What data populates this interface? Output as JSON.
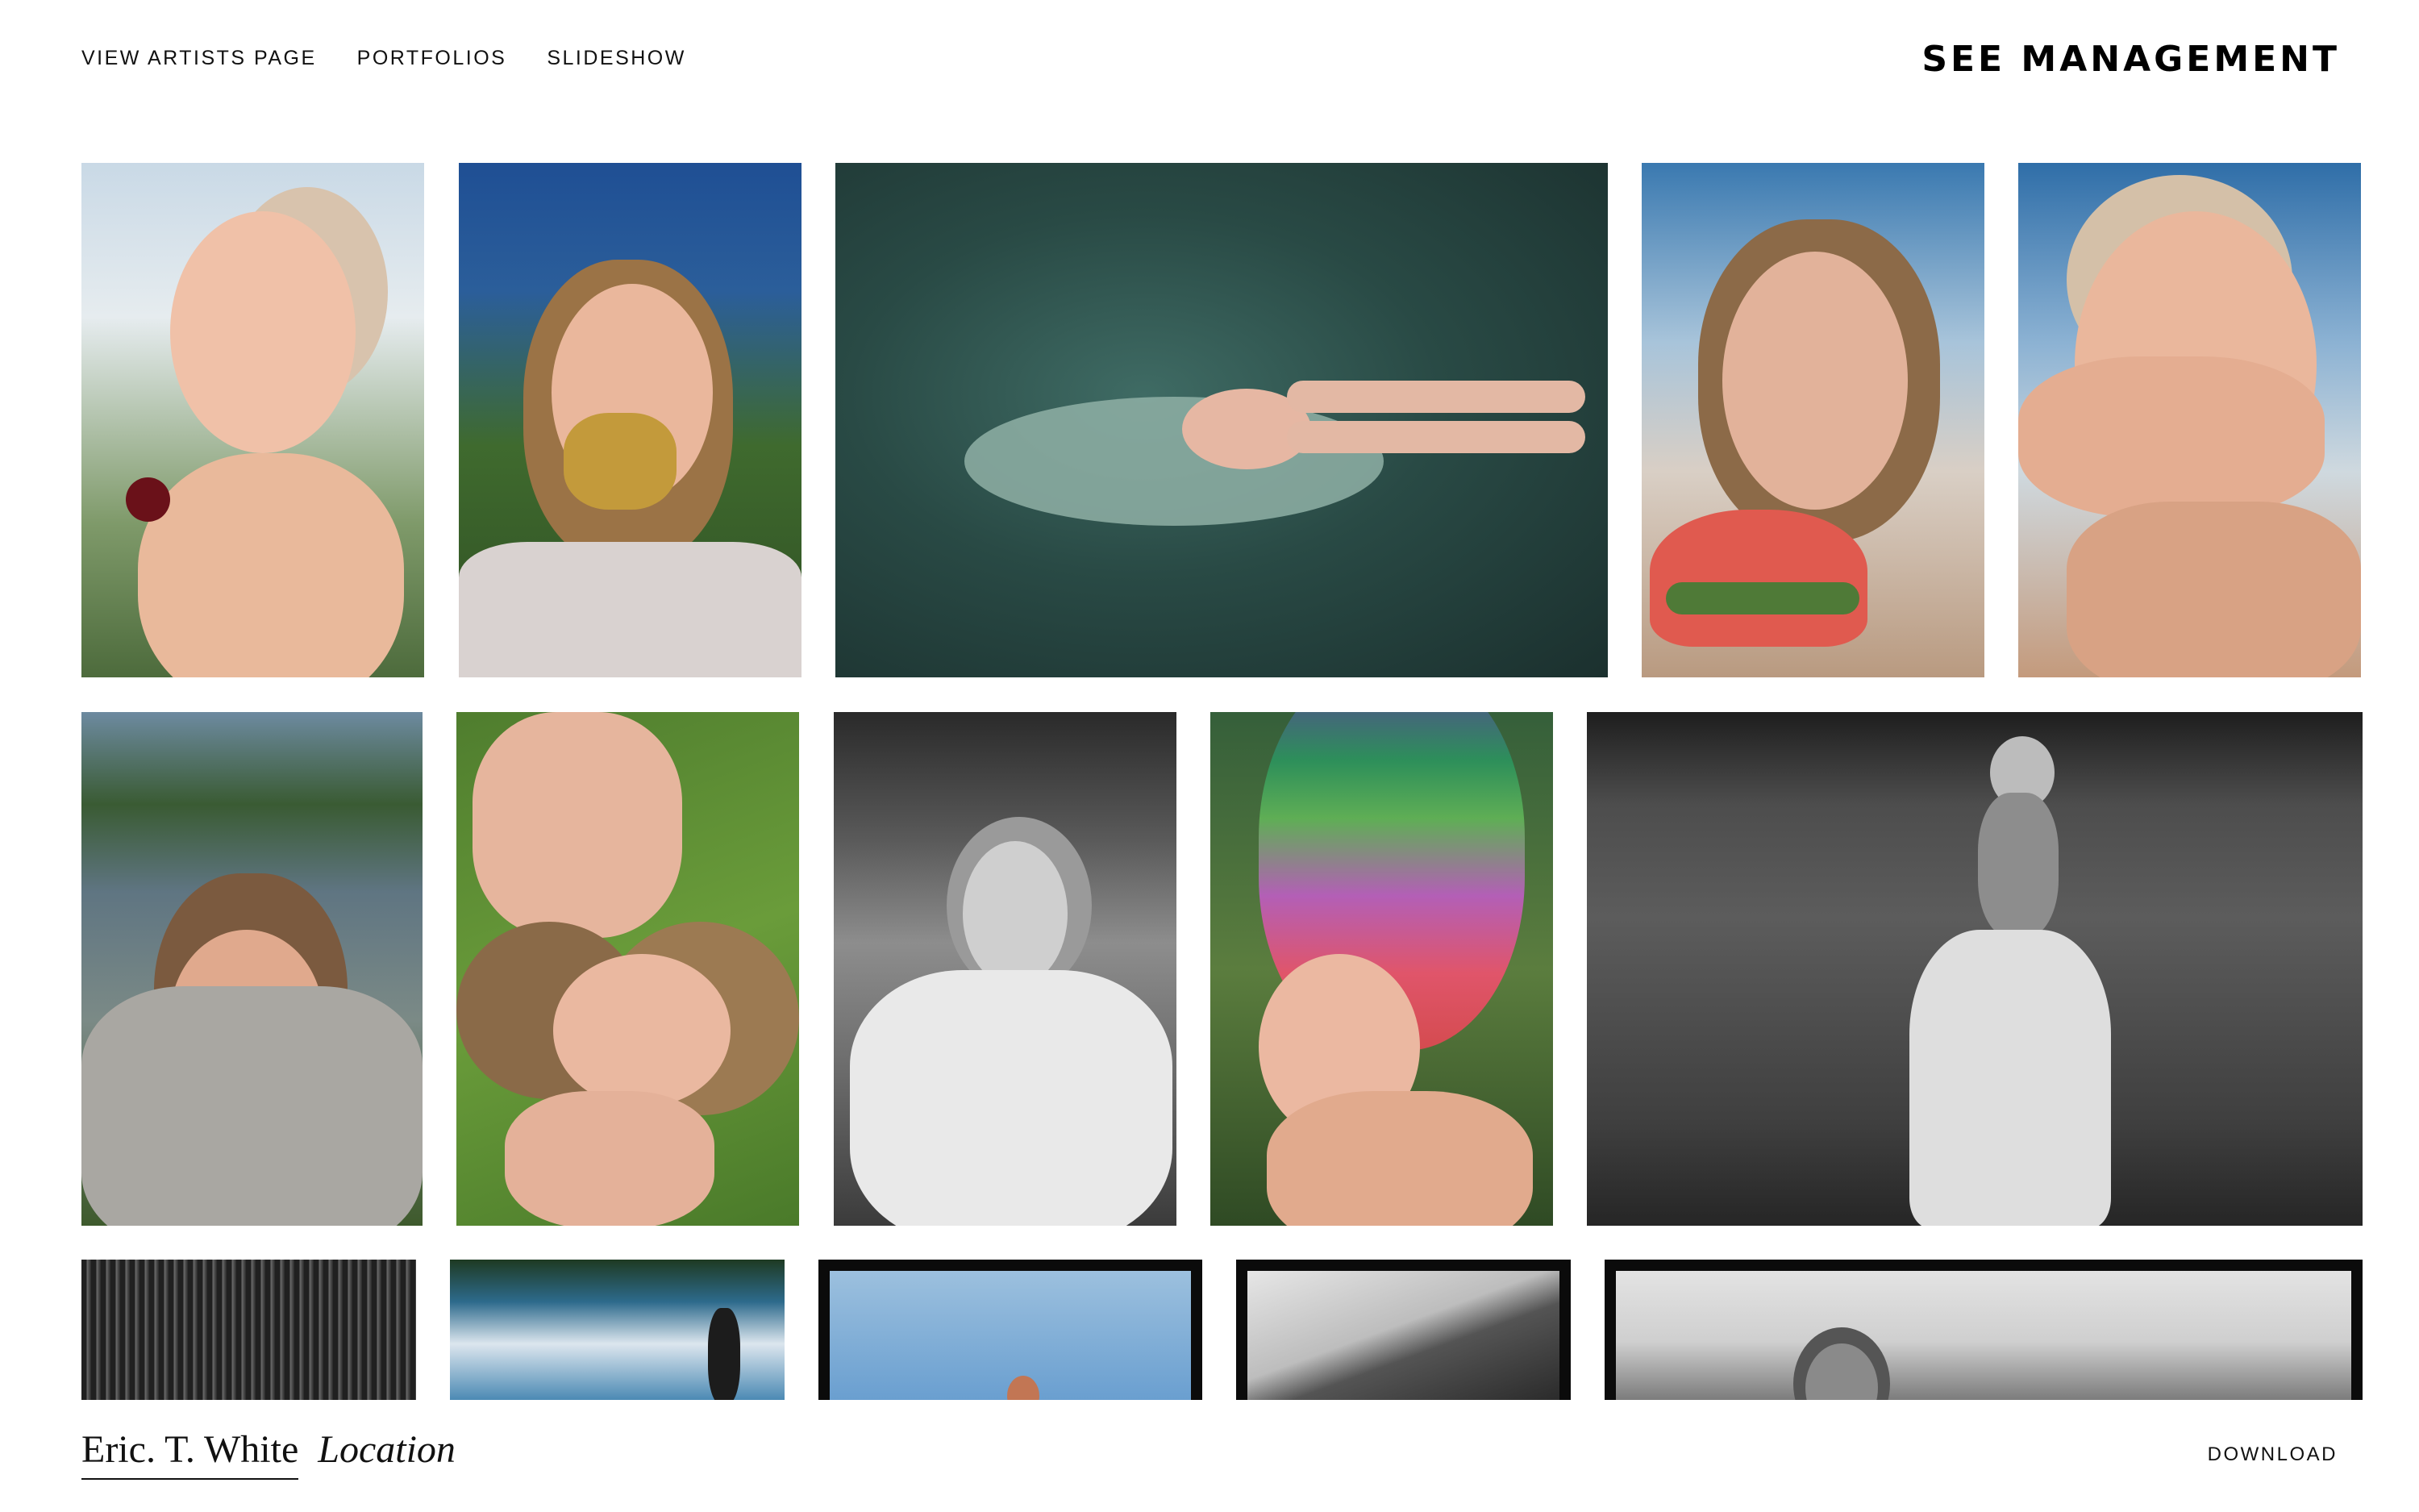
{
  "header": {
    "nav": [
      {
        "label": "VIEW ARTISTS PAGE"
      },
      {
        "label": "PORTFOLIOS"
      },
      {
        "label": "SLIDESHOW"
      }
    ],
    "brand": "SEE MANAGEMENT"
  },
  "gallery": {
    "rows": [
      {
        "tiles": [
          {
            "kind": "color",
            "subject": "smiling woman holding cherry"
          },
          {
            "kind": "color",
            "subject": "woman holding gold butterfly"
          },
          {
            "kind": "color",
            "subject": "woman floating in water"
          },
          {
            "kind": "color",
            "subject": "woman eating watermelon"
          },
          {
            "kind": "color",
            "subject": "woman hand over mouth"
          }
        ]
      },
      {
        "tiles": [
          {
            "kind": "color",
            "subject": "woman in knit top by lake"
          },
          {
            "kind": "color",
            "subject": "two women lying in grass"
          },
          {
            "kind": "bw",
            "subject": "woman in ruffled white dress"
          },
          {
            "kind": "color",
            "subject": "woman in rainbow knit hood"
          },
          {
            "kind": "bw",
            "subject": "woman in tulle skirt on hillside"
          }
        ]
      },
      {
        "tiles": [
          {
            "kind": "bw",
            "subject": "tall grass"
          },
          {
            "kind": "color",
            "subject": "sky reflection"
          },
          {
            "kind": "color",
            "subject": "figure with outstretched arms"
          },
          {
            "kind": "bw",
            "subject": "hills"
          },
          {
            "kind": "bw",
            "subject": "woman in desert landscape"
          }
        ]
      }
    ]
  },
  "footer": {
    "artist_name": "Eric. T. White",
    "location": "Location",
    "download_label": "DOWNLOAD"
  },
  "colors": {
    "background": "#ffffff",
    "text": "#111111"
  }
}
